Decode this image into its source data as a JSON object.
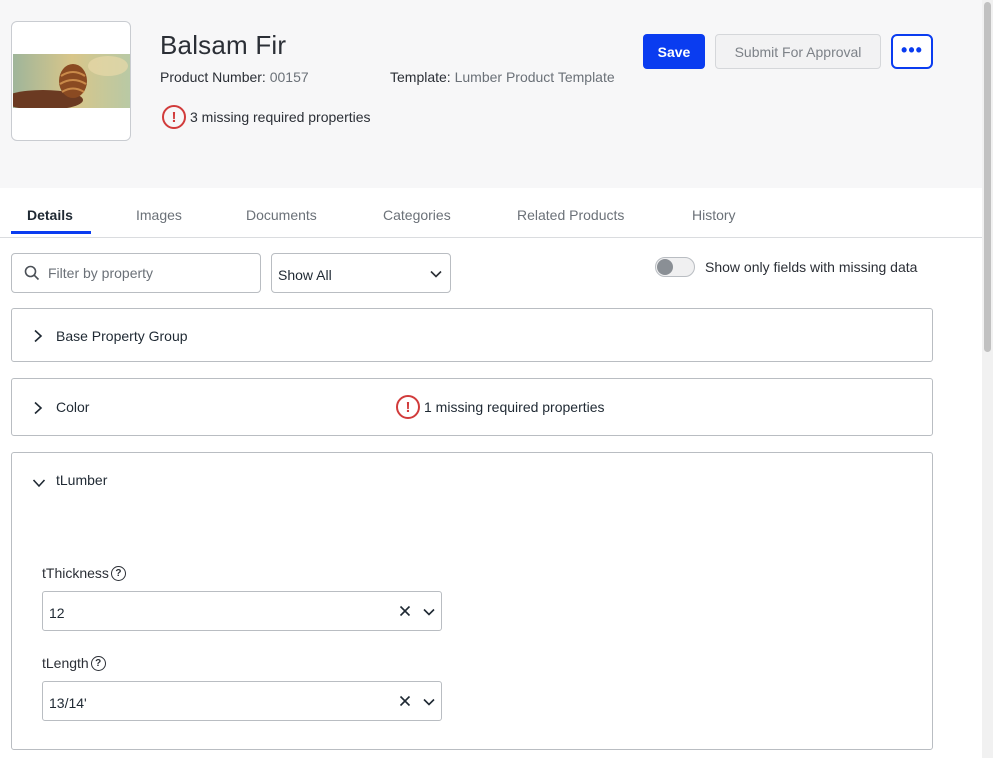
{
  "product": {
    "title": "Balsam Fir",
    "number_label": "Product Number:",
    "number_value": "00157",
    "template_label": "Template:",
    "template_value": "Lumber Product Template",
    "missing_summary": "3 missing required properties",
    "thumbnail": "pine-cone-image"
  },
  "actions": {
    "save_label": "Save",
    "submit_label": "Submit For Approval",
    "more_label": "•••"
  },
  "tabs": [
    {
      "label": "Details",
      "active": true
    },
    {
      "label": "Images"
    },
    {
      "label": "Documents"
    },
    {
      "label": "Categories"
    },
    {
      "label": "Related Products"
    },
    {
      "label": "History"
    }
  ],
  "toolbar": {
    "filter_placeholder": "Filter by property",
    "show_select_value": "Show All",
    "toggle_label": "Show only fields with missing data",
    "toggle_on": false
  },
  "groups": [
    {
      "title": "Base Property Group",
      "expanded": false
    },
    {
      "title": "Color",
      "expanded": false,
      "missing": "1 missing required properties"
    },
    {
      "title": "tLumber",
      "expanded": true,
      "fields": [
        {
          "label": "tThickness",
          "value": "12"
        },
        {
          "label": "tLength",
          "value": "13/14'"
        }
      ]
    }
  ],
  "colors": {
    "accent": "#0a3cf0",
    "warning": "#d13b3b",
    "header_bg": "#f7f7f8"
  },
  "icons": {
    "search": "search-icon",
    "chevron_down": "chevron-down-icon",
    "chevron_right": "chevron-right-icon",
    "warning": "exclamation-circle-icon",
    "help": "question-circle-icon",
    "clear": "close-icon"
  }
}
